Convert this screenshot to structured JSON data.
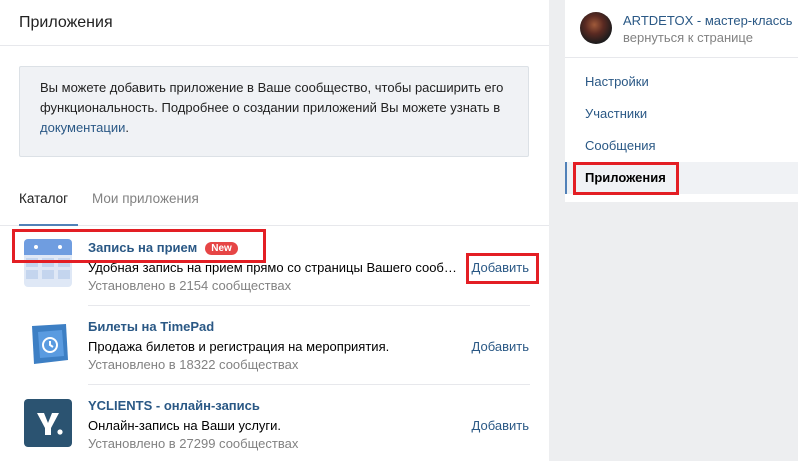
{
  "page": {
    "title": "Приложения"
  },
  "info": {
    "text_before": "Вы можете добавить приложение в Ваше сообщество, чтобы расширить его функциональность. Подробнее о создании приложений Вы можете узнать в ",
    "link_text": "документации",
    "text_after": "."
  },
  "tabs": [
    {
      "label": "Каталог",
      "active": true
    },
    {
      "label": "Мои приложения",
      "active": false
    }
  ],
  "apps": [
    {
      "name": "Запись на прием",
      "badge": "New",
      "description": "Удобная запись на прием прямо со страницы Вашего сообщества",
      "installs": "Установлено в 2154 сообществах",
      "add_label": "Добавить",
      "icon": "calendar-icon"
    },
    {
      "name": "Билеты на TimePad",
      "badge": "",
      "description": "Продажа билетов и регистрация на мероприятия.",
      "installs": "Установлено в 18322 сообществах",
      "add_label": "Добавить",
      "icon": "timepad-icon"
    },
    {
      "name": "YCLIENTS - онлайн-запись",
      "badge": "",
      "description": "Онлайн-запись на Ваши услуги.",
      "installs": "Установлено в 27299 сообществах",
      "add_label": "Добавить",
      "icon": "yclients-icon"
    }
  ],
  "sidebar": {
    "community_name": "ARTDETOX - мастер-классы",
    "back_label": "вернуться к странице",
    "items": [
      {
        "label": "Настройки",
        "active": false
      },
      {
        "label": "Участники",
        "active": false
      },
      {
        "label": "Сообщения",
        "active": false
      },
      {
        "label": "Приложения",
        "active": true
      }
    ]
  },
  "colors": {
    "link": "#2a5885",
    "accent": "#5181b8",
    "highlight": "#e31e24",
    "badge": "#e64646"
  }
}
